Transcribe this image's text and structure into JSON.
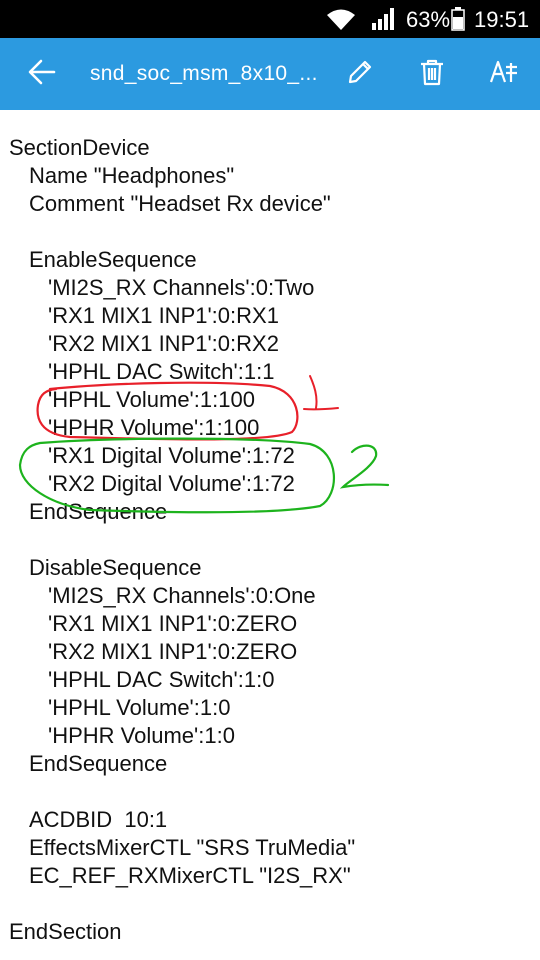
{
  "status_bar": {
    "battery_percent": "63%",
    "time": "19:51",
    "icons": [
      "wifi-icon",
      "signal-icon",
      "battery-icon"
    ]
  },
  "toolbar": {
    "title": "snd_soc_msm_8x10_...",
    "icons": [
      "back-arrow-icon",
      "edit-pencil-icon",
      "trash-icon",
      "font-size-icon"
    ],
    "background": "#2c9ae0"
  },
  "document": {
    "lines": [
      {
        "indent": 0,
        "text": "SectionDevice"
      },
      {
        "indent": 1,
        "text": "Name \"Headphones\""
      },
      {
        "indent": 1,
        "text": "Comment \"Headset Rx device\""
      },
      {
        "indent": 0,
        "text": ""
      },
      {
        "indent": 1,
        "text": "EnableSequence"
      },
      {
        "indent": 2,
        "text": "'MI2S_RX Channels':0:Two"
      },
      {
        "indent": 2,
        "text": "'RX1 MIX1 INP1':0:RX1"
      },
      {
        "indent": 2,
        "text": "'RX2 MIX1 INP1':0:RX2"
      },
      {
        "indent": 2,
        "text": "'HPHL DAC Switch':1:1"
      },
      {
        "indent": 2,
        "text": "'HPHL Volume':1:100"
      },
      {
        "indent": 2,
        "text": "'HPHR Volume':1:100"
      },
      {
        "indent": 2,
        "text": "'RX1 Digital Volume':1:72"
      },
      {
        "indent": 2,
        "text": "'RX2 Digital Volume':1:72"
      },
      {
        "indent": 1,
        "text": "EndSequence"
      },
      {
        "indent": 0,
        "text": ""
      },
      {
        "indent": 1,
        "text": "DisableSequence"
      },
      {
        "indent": 2,
        "text": "'MI2S_RX Channels':0:One"
      },
      {
        "indent": 2,
        "text": "'RX1 MIX1 INP1':0:ZERO"
      },
      {
        "indent": 2,
        "text": "'RX2 MIX1 INP1':0:ZERO"
      },
      {
        "indent": 2,
        "text": "'HPHL DAC Switch':1:0"
      },
      {
        "indent": 2,
        "text": "'HPHL Volume':1:0"
      },
      {
        "indent": 2,
        "text": "'HPHR Volume':1:0"
      },
      {
        "indent": 1,
        "text": "EndSequence"
      },
      {
        "indent": 0,
        "text": ""
      },
      {
        "indent": 1,
        "text": "ACDBID  10:1"
      },
      {
        "indent": 1,
        "text": "EffectsMixerCTL \"SRS TruMedia\""
      },
      {
        "indent": 1,
        "text": "EC_REF_RXMixerCTL \"I2S_RX\""
      },
      {
        "indent": 0,
        "text": ""
      },
      {
        "indent": 0,
        "text": "EndSection"
      }
    ]
  },
  "annotations": {
    "red_label": "1",
    "green_label": "2",
    "red_color": "#e8202a",
    "green_color": "#1db31d"
  }
}
